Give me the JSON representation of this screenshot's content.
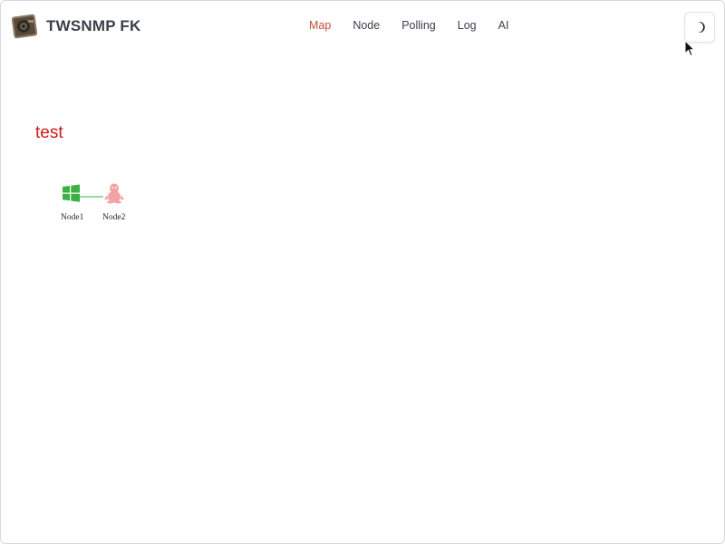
{
  "app": {
    "title": "TWSNMP FK"
  },
  "nav": {
    "items": [
      {
        "label": "Map",
        "active": true
      },
      {
        "label": "Node",
        "active": false
      },
      {
        "label": "Polling",
        "active": false
      },
      {
        "label": "Log",
        "active": false
      },
      {
        "label": "AI",
        "active": false
      }
    ]
  },
  "theme_toggle": {
    "icon": "moon-icon"
  },
  "map": {
    "title": "test",
    "nodes": [
      {
        "name": "Node1",
        "icon": "windows-icon",
        "color": "#3cb043"
      },
      {
        "name": "Node2",
        "icon": "linux-icon",
        "color": "#f4a3a3"
      }
    ],
    "lines": [
      {
        "from": "Node1",
        "to": "Node2",
        "color": "#3cb043"
      }
    ]
  },
  "colors": {
    "active_nav": "#c0503a",
    "text": "#3a3f4a",
    "map_title": "#cc1a1a"
  }
}
